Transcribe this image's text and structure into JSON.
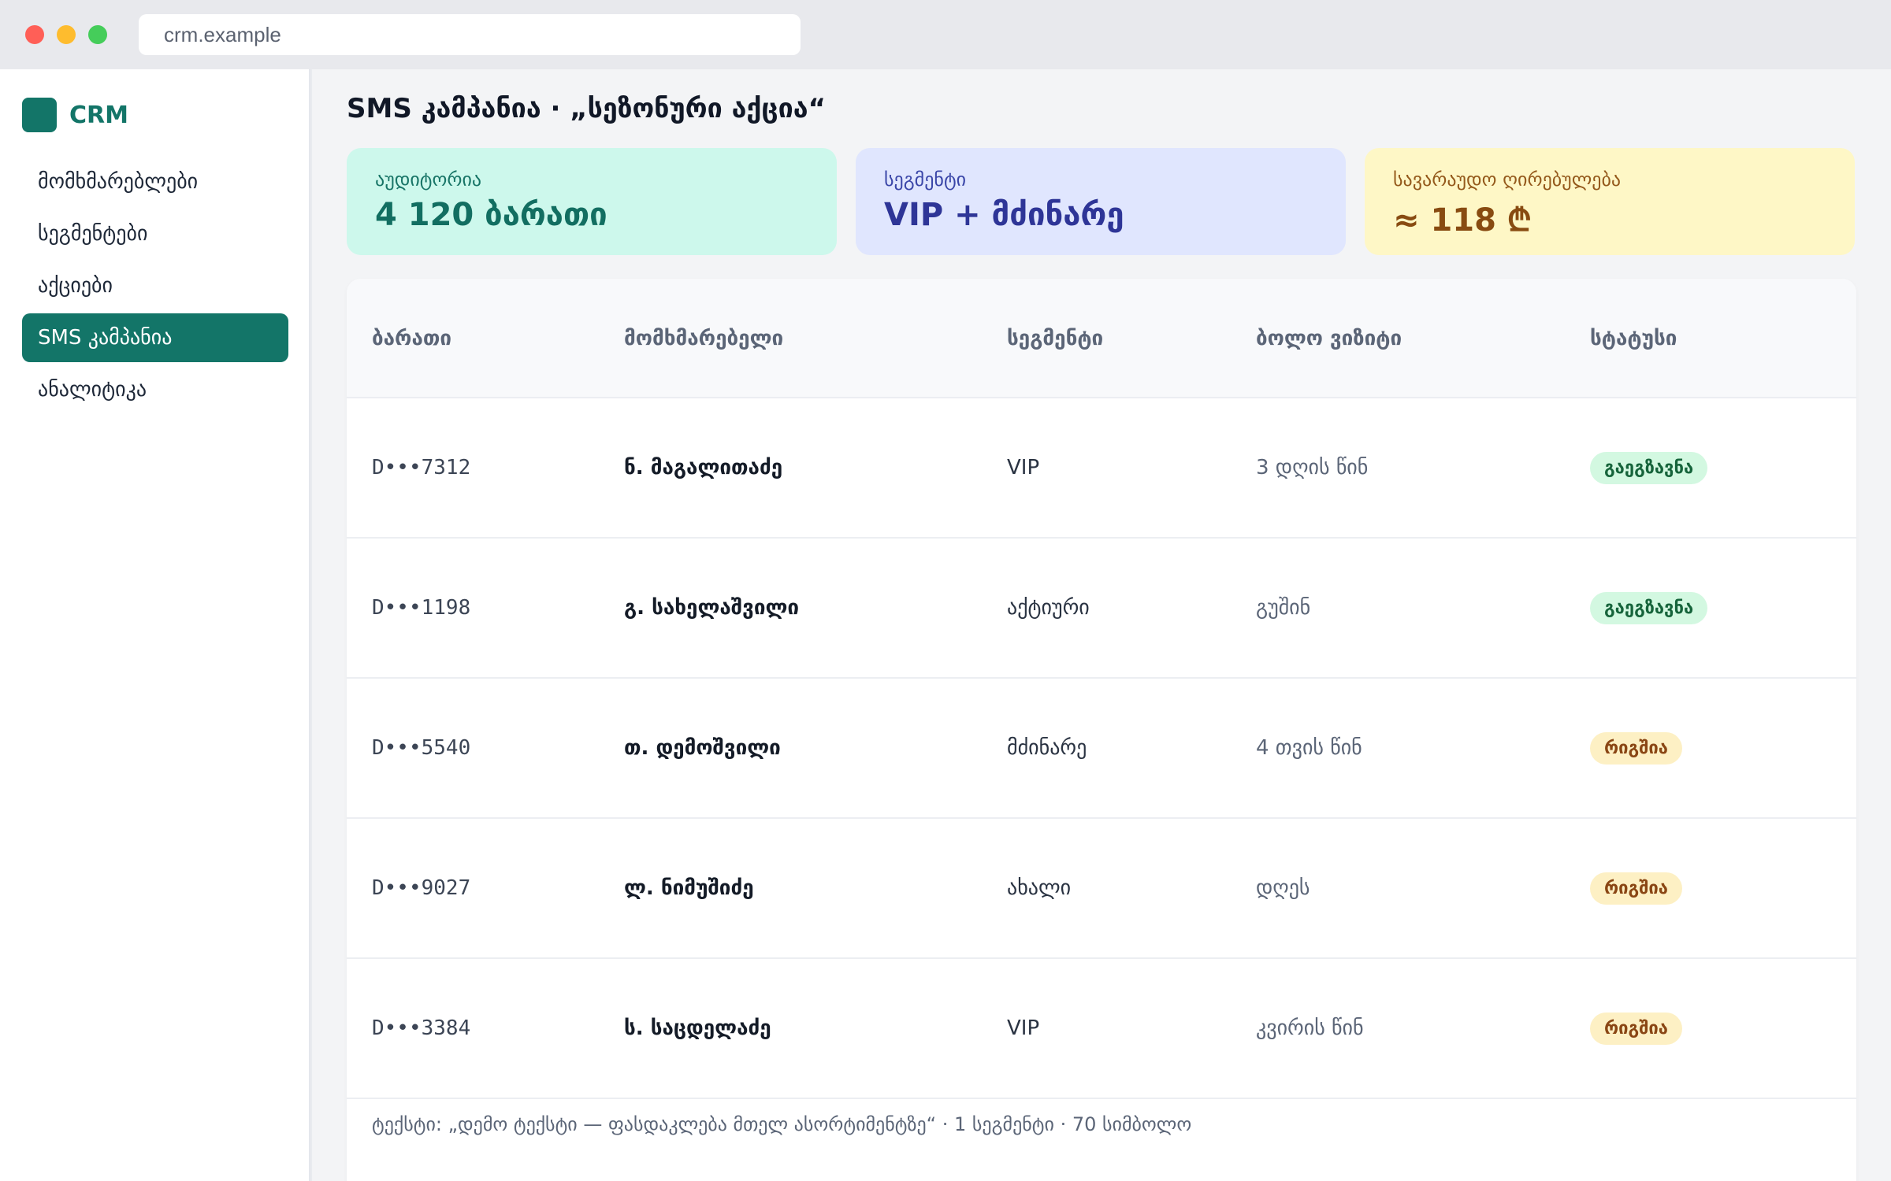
{
  "browser": {
    "url": "crm.example"
  },
  "sidebar": {
    "brand": "CRM",
    "items": [
      {
        "label": "მომხმარებლები",
        "active": false
      },
      {
        "label": "სეგმენტები",
        "active": false
      },
      {
        "label": "აქციები",
        "active": false
      },
      {
        "label": "SMS კამპანია",
        "active": true
      },
      {
        "label": "ანალიტიკა",
        "active": false
      }
    ]
  },
  "main": {
    "title": "SMS კამპანია · „სეზონური აქცია“",
    "cards": [
      {
        "label": "აუდიტორია",
        "value": "4 120 ბარათი"
      },
      {
        "label": "სეგმენტი",
        "value": "VIP + მძინარე"
      },
      {
        "label": "სავარაუდო ღირებულება",
        "value": "≈ 118 ₾"
      }
    ],
    "table": {
      "columns": [
        "ბარათი",
        "მომხმარებელი",
        "სეგმენტი",
        "ბოლო ვიზიტი",
        "სტატუსი"
      ],
      "rows": [
        {
          "card": "D•••7312",
          "customer": "ნ. მაგალითაძე",
          "segment": "VIP",
          "last_visit": "3 დღის წინ",
          "status": "გაეგზავნა"
        },
        {
          "card": "D•••1198",
          "customer": "გ. სახელაშვილი",
          "segment": "აქტიური",
          "last_visit": "გუშინ",
          "status": "გაეგზავნა"
        },
        {
          "card": "D•••5540",
          "customer": "თ. დემოშვილი",
          "segment": "მძინარე",
          "last_visit": "4 თვის წინ",
          "status": "რიგშია"
        },
        {
          "card": "D•••9027",
          "customer": "ლ. ნიმუშიძე",
          "segment": "ახალი",
          "last_visit": "დღეს",
          "status": "რიგშია"
        },
        {
          "card": "D•••3384",
          "customer": "ს. საცდელაძე",
          "segment": "VIP",
          "last_visit": "კვირის წინ",
          "status": "რიგშია"
        }
      ]
    },
    "footer": "ტექსტი: „დემო ტექსტი — ფასდაკლება მთელ ასორტიმენტზე“ · 1 სეგმენტი · 70 სიმბოლო"
  }
}
